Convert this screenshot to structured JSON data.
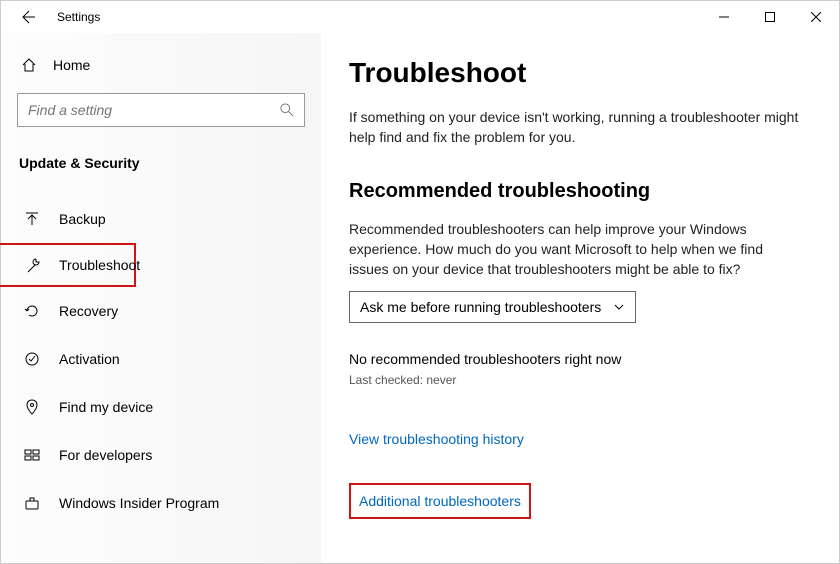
{
  "titlebar": {
    "app_name": "Settings"
  },
  "sidebar": {
    "home_label": "Home",
    "search_placeholder": "Find a setting",
    "category_label": "Update & Security",
    "items": [
      {
        "label": "Backup"
      },
      {
        "label": "Troubleshoot"
      },
      {
        "label": "Recovery"
      },
      {
        "label": "Activation"
      },
      {
        "label": "Find my device"
      },
      {
        "label": "For developers"
      },
      {
        "label": "Windows Insider Program"
      }
    ]
  },
  "main": {
    "title": "Troubleshoot",
    "intro": "If something on your device isn't working, running a troubleshooter might help find and fix the problem for you.",
    "section_heading": "Recommended troubleshooting",
    "section_body": "Recommended troubleshooters can help improve your Windows experience. How much do you want Microsoft to help when we find issues on your device that troubleshooters might be able to fix?",
    "dropdown_value": "Ask me before running troubleshooters",
    "no_recommended": "No recommended troubleshooters right now",
    "last_checked": "Last checked: never",
    "link_history": "View troubleshooting history",
    "link_additional": "Additional troubleshooters"
  }
}
